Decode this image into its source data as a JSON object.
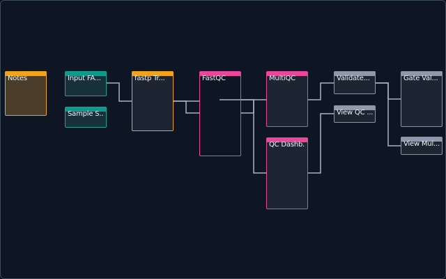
{
  "nodes": {
    "notes": "Notes",
    "input_fa": "Input FA...",
    "sample_s": "Sample S...",
    "fastp": "fastp Tr...",
    "fastqc": "FastQC",
    "multiqc": "MultiQC",
    "qc_dashboard": "QC Dashb...",
    "validate": "Validate...",
    "view_qc": "View QC ...",
    "gate_val": "Gate Val...",
    "view_mul": "View Mul..."
  },
  "colors": {
    "background": "#0e1624",
    "wire": "#a9b3c2",
    "note_accent": "#f0a31c",
    "input_accent": "#0e9a8a",
    "process_accent": "#f0a31c",
    "report_accent": "#e8479a",
    "output_accent": "#8e99aa"
  }
}
